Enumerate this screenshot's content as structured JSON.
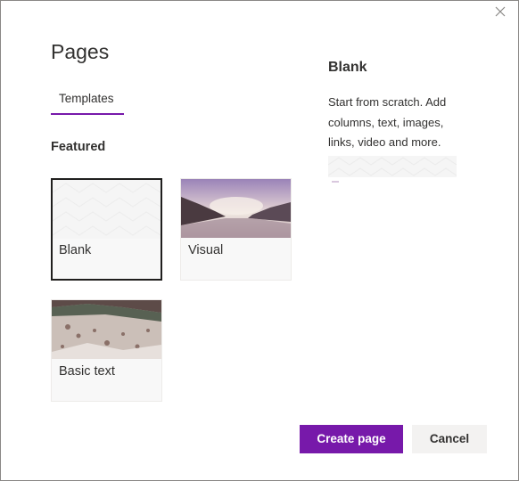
{
  "dialog": {
    "title": "Pages",
    "close_icon": "close-icon"
  },
  "tabs": [
    {
      "label": "Templates",
      "selected": true
    }
  ],
  "section": {
    "heading": "Featured"
  },
  "templates": [
    {
      "label": "Blank",
      "selected": true
    },
    {
      "label": "Visual",
      "selected": false
    },
    {
      "label": "Basic text",
      "selected": false
    }
  ],
  "preview": {
    "title": "Blank",
    "description": "Start from scratch. Add columns, text, images, links, video and more."
  },
  "actions": {
    "create_label": "Create page",
    "cancel_label": "Cancel"
  },
  "colors": {
    "accent": "#7719aa",
    "selected_border": "#201f1e",
    "secondary_button": "#f3f2f1"
  }
}
